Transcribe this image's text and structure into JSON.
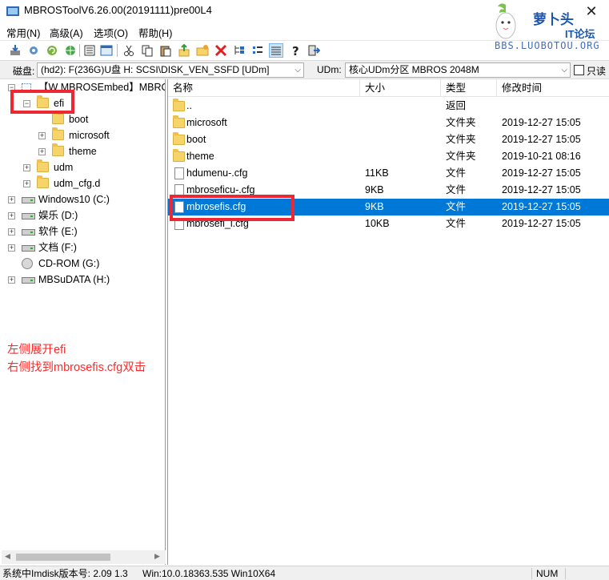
{
  "window": {
    "title": "MBROSToolV6.26.00(20191111)pre00L4",
    "watermark_text": "萝卜头",
    "watermark_subtext": "IT论坛",
    "watermark_url": "BBS.LUOBOTOU.ORG"
  },
  "menu": [
    "常用(N)",
    "高级(A)",
    "选项(O)",
    "帮助(H)"
  ],
  "toolbar": {
    "icons": [
      "mount-icon",
      "settings-icon",
      "refresh-icon",
      "web-icon",
      "list-icon",
      "window-icon",
      "cut-icon",
      "copy-icon",
      "paste-icon",
      "up-icon",
      "newfolder-icon",
      "delete-icon",
      "tree-icon",
      "detail-icon",
      "grid-icon",
      "help-icon",
      "exit-icon"
    ]
  },
  "diskbar": {
    "disk_label": "磁盘:",
    "disk_value": "(hd2): F(236G)U盘  H: SCSI\\DISK_VEN_SSFD [UDm]",
    "udm_label": "UDm:",
    "udm_value": "核心UDm分区 MBROS 2048M",
    "readonly_label": "只读"
  },
  "tree": [
    {
      "label": "【W MBROSEmbed】MBRO",
      "type": "root",
      "expander": "-"
    },
    {
      "label": "efi",
      "type": "folder",
      "expander": "-"
    },
    {
      "label": "boot",
      "type": "folder",
      "expander": ""
    },
    {
      "label": "microsoft",
      "type": "folder",
      "expander": "+"
    },
    {
      "label": "theme",
      "type": "folder",
      "expander": "+"
    },
    {
      "label": "udm",
      "type": "folder",
      "expander": "+"
    },
    {
      "label": "udm_cfg.d",
      "type": "folder",
      "expander": "+"
    },
    {
      "label": "Windows10 (C:)",
      "type": "drive",
      "expander": "+"
    },
    {
      "label": "娱乐 (D:)",
      "type": "drive",
      "expander": "+"
    },
    {
      "label": "软件 (E:)",
      "type": "drive",
      "expander": "+"
    },
    {
      "label": "文档 (F:)",
      "type": "drive",
      "expander": "+"
    },
    {
      "label": "CD-ROM (G:)",
      "type": "cdrom",
      "expander": ""
    },
    {
      "label": "MBSuDATA (H:)",
      "type": "drive",
      "expander": "+"
    }
  ],
  "annotation": [
    "左侧展开efi",
    "右侧找到mbrosefis.cfg双击"
  ],
  "list": {
    "columns": [
      "名称",
      "大小",
      "类型",
      "修改时间"
    ],
    "rows": [
      {
        "name": "..",
        "size": "",
        "type": "返回",
        "modified": "",
        "kind": "folder"
      },
      {
        "name": "microsoft",
        "size": "",
        "type": "文件夹",
        "modified": "2019-12-27 15:05",
        "kind": "folder"
      },
      {
        "name": "boot",
        "size": "",
        "type": "文件夹",
        "modified": "2019-12-27 15:05",
        "kind": "folder"
      },
      {
        "name": "theme",
        "size": "",
        "type": "文件夹",
        "modified": "2019-10-21 08:16",
        "kind": "folder"
      },
      {
        "name": "hdumenu-.cfg",
        "size": "11KB",
        "type": "文件",
        "modified": "2019-12-27 15:05",
        "kind": "file"
      },
      {
        "name": "mbroseficu-.cfg",
        "size": "9KB",
        "type": "文件",
        "modified": "2019-12-27 15:05",
        "kind": "file"
      },
      {
        "name": "mbrosefis.cfg",
        "size": "9KB",
        "type": "文件",
        "modified": "2019-12-27 15:05",
        "kind": "file",
        "selected": true
      },
      {
        "name": "mbrosefi_i.cfg",
        "size": "10KB",
        "type": "文件",
        "modified": "2019-12-27 15:05",
        "kind": "file"
      }
    ]
  },
  "status": {
    "version": "系统中Imdisk版本号: 2.09 1.3",
    "os": "Win:10.0.18363.535 Win10X64",
    "num": "NUM"
  },
  "colors": {
    "selection": "#0078d7",
    "highlight_box": "#ee2833",
    "annotation": "#ff2a2a",
    "folder": "#f6d46a"
  }
}
